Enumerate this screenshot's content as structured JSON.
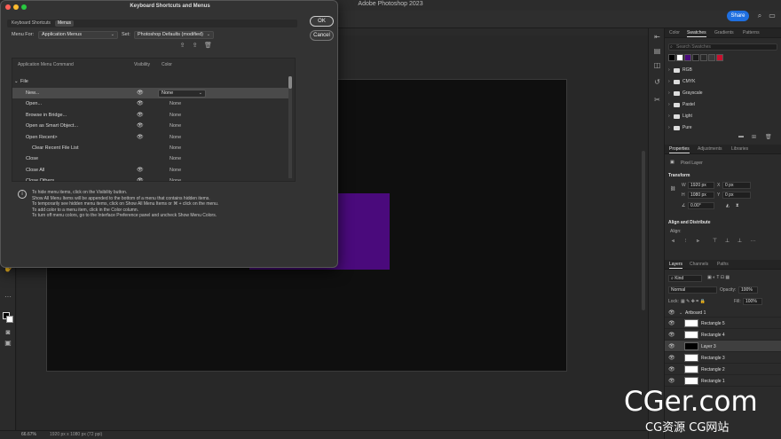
{
  "app": {
    "title": "Adobe Photoshop 2023",
    "share_label": "Share"
  },
  "statusbar": {
    "zoom": "66.67%",
    "doc_info": "1920 px x 1080 px (72 ppi)"
  },
  "dialog": {
    "title": "Keyboard Shortcuts and Menus",
    "tabs": [
      "Keyboard Shortcuts",
      "Menus"
    ],
    "active_tab": "Menus",
    "ok_label": "OK",
    "cancel_label": "Cancel",
    "menu_for_label": "Menu For:",
    "menu_for_value": "Application Menus",
    "set_label": "Set:",
    "set_value": "Photoshop Defaults (modified)",
    "columns": {
      "command": "Application Menu Command",
      "visibility": "Visibility",
      "color": "Color"
    },
    "group": "File",
    "rows": [
      {
        "label": "New...",
        "visible": true,
        "color": "None",
        "selected": true
      },
      {
        "label": "Open...",
        "visible": true,
        "color": "None"
      },
      {
        "label": "Browse in Bridge...",
        "visible": true,
        "color": "None"
      },
      {
        "label": "Open as Smart Object...",
        "visible": true,
        "color": "None"
      },
      {
        "label": "Open Recent>",
        "visible": true,
        "color": "None"
      },
      {
        "label": "Clear Recent File List",
        "visible": false,
        "color": "None"
      },
      {
        "label": "Close",
        "visible": false,
        "color": "None"
      },
      {
        "label": "Close All",
        "visible": true,
        "color": "None"
      },
      {
        "label": "Close Others",
        "visible": true,
        "color": "None"
      }
    ],
    "info_lines": [
      "To hide menu items, click on the Visibility button.",
      "Show All Menu Items will be appended to the bottom of a menu that contains hidden items.",
      "To temporarily see hidden menu items, click on Show All Menu Items or ⌘ + click on the menu.",
      "To add color to a menu item, click in the Color column.",
      "To turn off menu colors, go to the Interface Preference panel and uncheck Show Menu Colors."
    ]
  },
  "swatches_panel": {
    "tabs": [
      "Color",
      "Swatches",
      "Gradients",
      "Patterns"
    ],
    "active_tab": "Swatches",
    "search_placeholder": "Search Swatches",
    "recent_colors": [
      "#000000",
      "#ffffff",
      "#4a0a7c",
      "#1a1a1a",
      "#2a2a2a",
      "#3a3a3a",
      "#c8102e"
    ],
    "folders": [
      "RGB",
      "CMYK",
      "Grayscale",
      "Pastel",
      "Light",
      "Pure"
    ]
  },
  "properties_panel": {
    "tabs": [
      "Properties",
      "Adjustments",
      "Libraries"
    ],
    "active_tab": "Properties",
    "layer_type": "Pixel Layer",
    "transform_label": "Transform",
    "w_label": "W",
    "w_value": "1920 px",
    "h_label": "H",
    "h_value": "1080 px",
    "x_label": "X",
    "x_value": "0 px",
    "y_label": "Y",
    "y_value": "0 px",
    "angle": "0.00°",
    "align_label": "Align and Distribute",
    "align_sub": "Align:"
  },
  "layers_panel": {
    "tabs": [
      "Layers",
      "Channels",
      "Paths"
    ],
    "active_tab": "Layers",
    "filter": "Kind",
    "blend_mode": "Normal",
    "opacity_label": "Opacity:",
    "opacity_value": "100%",
    "lock_label": "Lock:",
    "fill_label": "Fill:",
    "fill_value": "100%",
    "artboard": "Artboard 1",
    "layers": [
      {
        "name": "Rectangle 5",
        "selected": false
      },
      {
        "name": "Rectangle 4",
        "selected": false
      },
      {
        "name": "Layer 3",
        "selected": true
      },
      {
        "name": "Rectangle 3",
        "selected": false
      },
      {
        "name": "Rectangle 2",
        "selected": false
      },
      {
        "name": "Rectangle 1",
        "selected": false
      }
    ]
  },
  "canvas": {
    "background": "#0f0f0f",
    "shape_color": "#4a0a7c"
  },
  "watermark": {
    "main": "CGer.com",
    "sub": "CG资源 CG网站"
  }
}
